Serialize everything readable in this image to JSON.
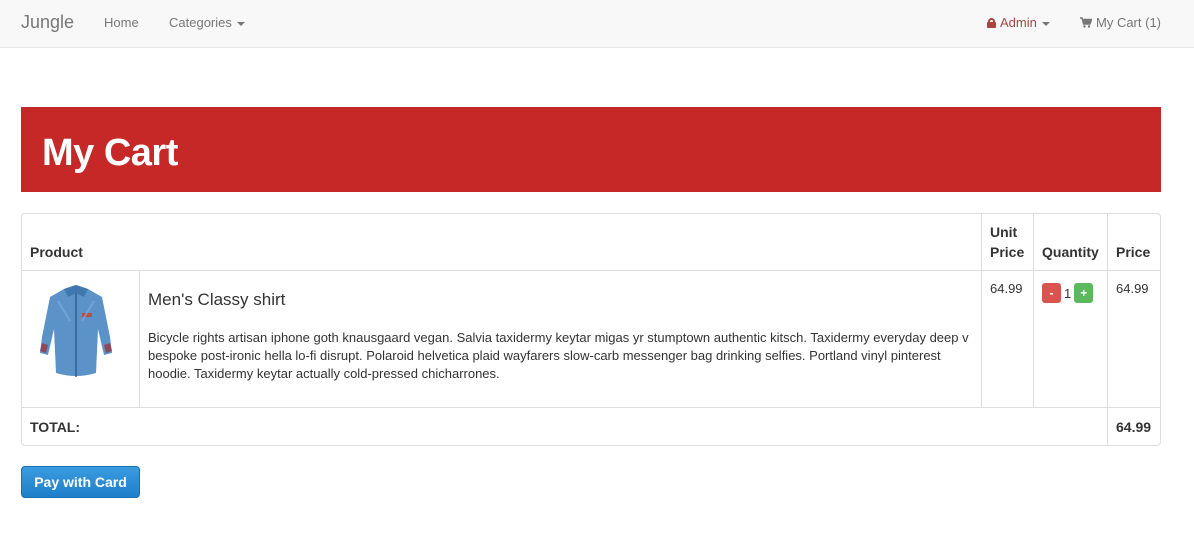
{
  "navbar": {
    "brand": "Jungle",
    "home": "Home",
    "categories": "Categories",
    "admin": "Admin",
    "cart": "My Cart (1)"
  },
  "banner": {
    "title": "My Cart"
  },
  "table": {
    "headers": {
      "product": "Product",
      "unit_price": "Unit Price",
      "quantity": "Quantity",
      "price": "Price"
    },
    "items": [
      {
        "name": "Men's Classy shirt",
        "description": "Bicycle rights artisan iphone goth knausgaard vegan. Salvia taxidermy keytar migas yr stumptown authentic kitsch. Taxidermy everyday deep v bespoke post-ironic hella lo-fi disrupt. Polaroid helvetica plaid wayfarers slow-carb messenger bag drinking selfies. Portland vinyl pinterest hoodie. Taxidermy keytar actually cold-pressed chicharrones.",
        "unit_price": "64.99",
        "quantity": "1",
        "minus": "-",
        "plus": "+",
        "price": "64.99"
      }
    ],
    "total_label": "TOTAL:",
    "total_value": "64.99"
  },
  "pay_button": "Pay with Card",
  "colors": {
    "banner": "#c62828",
    "minus": "#d9534f",
    "plus": "#5cb85c",
    "pay": "#1f7fc9",
    "admin": "#a94442"
  },
  "icons": {
    "admin": "lock-icon",
    "cart": "shopping-cart-icon",
    "dropdown": "caret-down-icon"
  }
}
